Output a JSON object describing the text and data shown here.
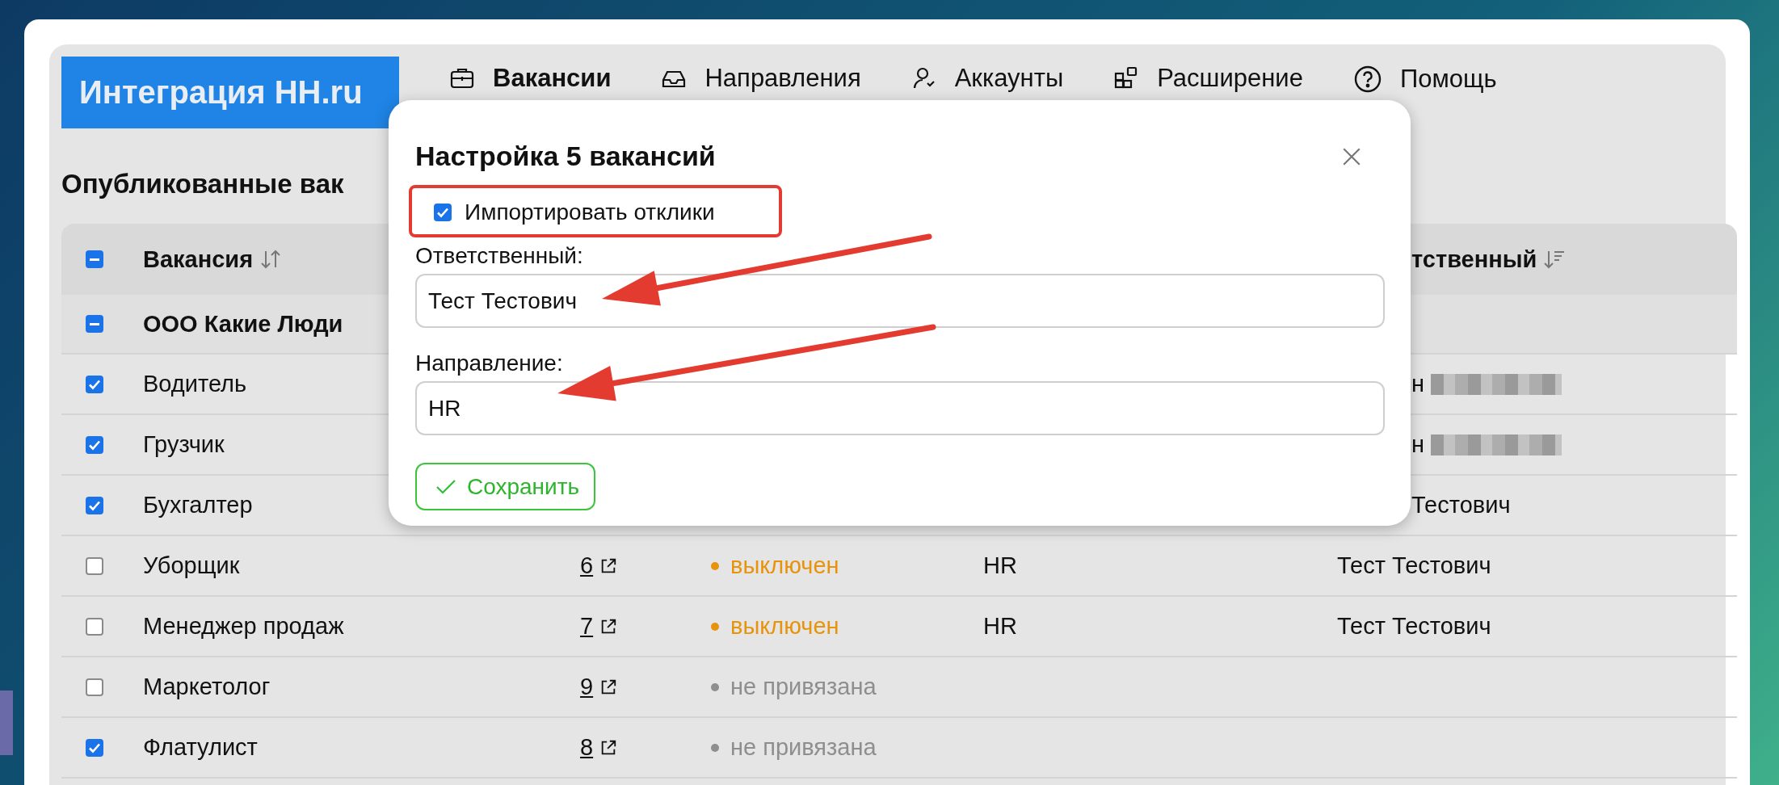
{
  "logo": "Интеграция HH.ru",
  "nav": [
    {
      "label": "Вакансии",
      "kind": "briefcase",
      "selected": true
    },
    {
      "label": "Направления",
      "kind": "inbox",
      "selected": false
    },
    {
      "label": "Аккаунты",
      "kind": "user",
      "selected": false
    },
    {
      "label": "Расширение",
      "kind": "blocks",
      "selected": false
    },
    {
      "label": "Помощь",
      "kind": "help",
      "selected": false
    }
  ],
  "heading": "Опубликованные вак",
  "table": {
    "select_all": {
      "indeterminate": true
    },
    "columns": [
      "Вакансия",
      "тственный"
    ],
    "group": {
      "name": "ООО Какие Люди",
      "indeterminate": true
    },
    "rows": [
      {
        "title": "Водитель",
        "checked": true,
        "responsible": "н",
        "redacted": true
      },
      {
        "title": "Грузчик",
        "checked": true,
        "responsible": "н",
        "redacted": true
      },
      {
        "title": "Бухгалтер",
        "checked": true,
        "responsible": "Тестович"
      },
      {
        "title": "Уборщик",
        "checked": false,
        "number": "6",
        "status": {
          "text": "выключен",
          "color": "#e8930c"
        },
        "direction": "HR",
        "responsible": "Тест Тестович"
      },
      {
        "title": "Менеджер продаж",
        "checked": false,
        "number": "7",
        "status": {
          "text": "выключен",
          "color": "#e8930c"
        },
        "direction": "HR",
        "responsible": "Тест Тестович"
      },
      {
        "title": "Маркетолог",
        "checked": false,
        "number": "9",
        "status": {
          "text": "не привязана",
          "color": "#8e8e8e"
        }
      },
      {
        "title": "Флатулист",
        "checked": true,
        "number": "8",
        "status": {
          "text": "не привязана",
          "color": "#8e8e8e"
        }
      }
    ]
  },
  "modal": {
    "title": "Настройка 5 вакансий",
    "import_label": "Импортировать отклики",
    "import_checked": true,
    "responsible_label": "Ответственный:",
    "responsible_value": "Тест Тестович",
    "direction_label": "Направление:",
    "direction_value": "HR",
    "save": "Сохранить"
  }
}
